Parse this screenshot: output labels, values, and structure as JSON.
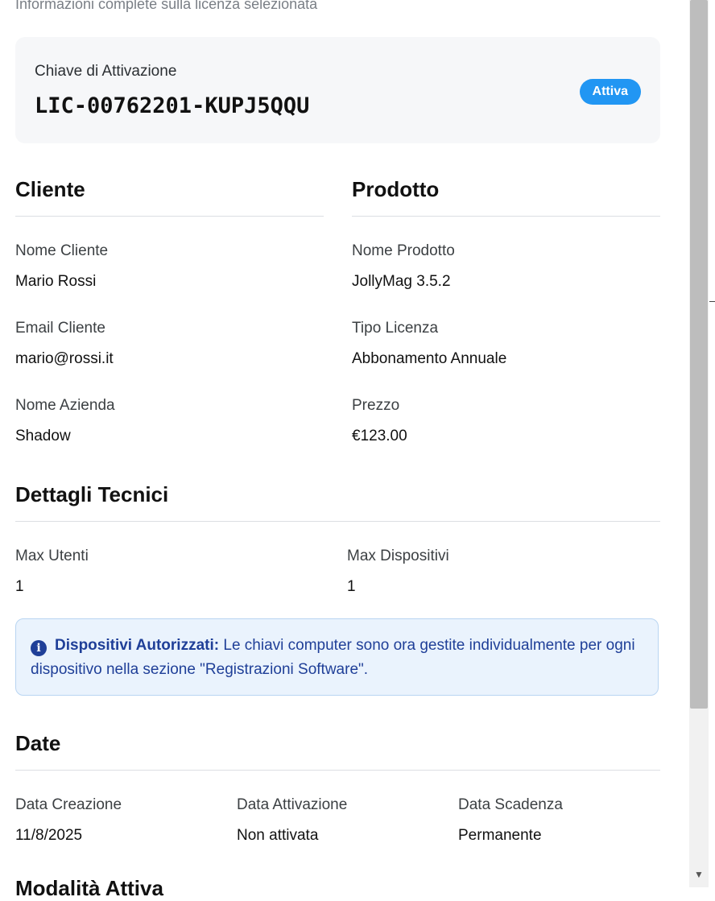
{
  "subtitle": "Informazioni complete sulla licenza selezionata",
  "activation": {
    "label": "Chiave di Attivazione",
    "key": "LIC-00762201-KUPJ5QQU",
    "status": "Attiva",
    "status_color": "#2196f3"
  },
  "client": {
    "title": "Cliente",
    "fields": [
      {
        "label": "Nome Cliente",
        "value": "Mario Rossi"
      },
      {
        "label": "Email Cliente",
        "value": "mario@rossi.it"
      },
      {
        "label": "Nome Azienda",
        "value": "Shadow"
      }
    ]
  },
  "product": {
    "title": "Prodotto",
    "fields": [
      {
        "label": "Nome Prodotto",
        "value": "JollyMag 3.5.2"
      },
      {
        "label": "Tipo Licenza",
        "value": "Abbonamento Annuale"
      },
      {
        "label": "Prezzo",
        "value": "€123.00"
      }
    ]
  },
  "technical": {
    "title": "Dettagli Tecnici",
    "fields": [
      {
        "label": "Max Utenti",
        "value": "1"
      },
      {
        "label": "Max Dispositivi",
        "value": "1"
      }
    ],
    "info": {
      "strong": "Dispositivi Autorizzati:",
      "text": "Le chiavi computer sono ora gestite individualmente per ogni dispositivo nella sezione \"Registrazioni Software\"."
    }
  },
  "dates": {
    "title": "Date",
    "fields": [
      {
        "label": "Data Creazione",
        "value": "11/8/2025"
      },
      {
        "label": "Data Attivazione",
        "value": "Non attivata"
      },
      {
        "label": "Data Scadenza",
        "value": "Permanente"
      }
    ]
  },
  "next_section_title": "Modalità Attiva",
  "colors": {
    "accent": "#2196f3",
    "info_bg": "#eaf3fd",
    "info_text": "#1f3f98"
  }
}
